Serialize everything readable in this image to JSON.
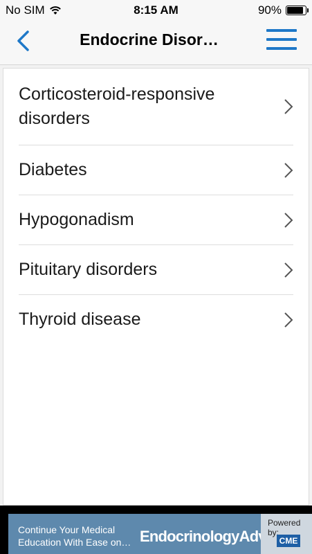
{
  "status_bar": {
    "carrier": "No SIM",
    "time": "8:15 AM",
    "battery_percent": "90%",
    "battery_level": 0.9,
    "wifi_icon": "wifi-icon"
  },
  "nav": {
    "title": "Endocrine Disor…",
    "back_icon": "chevron-left-icon",
    "menu_icon": "hamburger-menu-icon",
    "accent_color": "#1e78c8"
  },
  "list": {
    "items": [
      {
        "label": "Corticosteroid-responsive disorders"
      },
      {
        "label": "Diabetes"
      },
      {
        "label": "Hypogonadism"
      },
      {
        "label": "Pituitary disorders"
      },
      {
        "label": "Thyroid disease"
      }
    ],
    "chevron_icon": "chevron-right-icon"
  },
  "ad": {
    "tagline": "Continue Your Medical Education With Ease on…",
    "brand": "EndocrinologyAdvisor",
    "powered_by": "Powered by:",
    "cme_label": "CME",
    "background_color": "#5e89ad"
  }
}
